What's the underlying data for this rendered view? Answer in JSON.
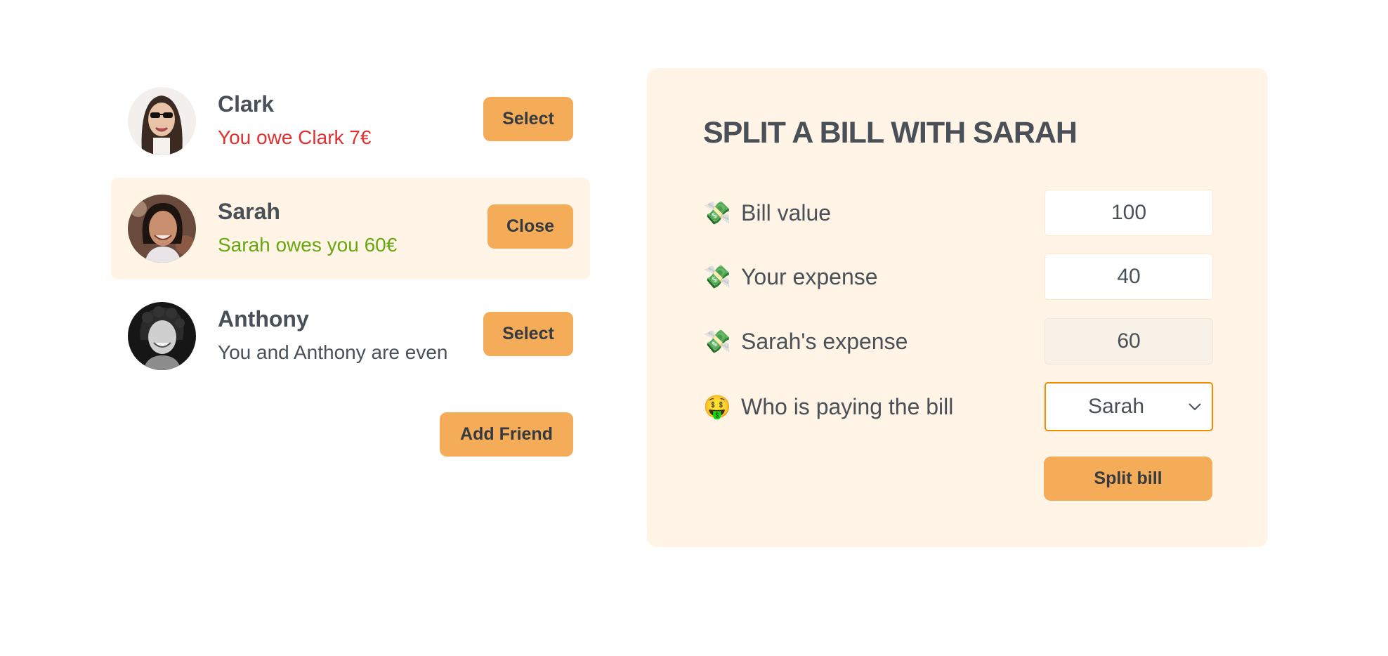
{
  "friends": [
    {
      "name": "Clark",
      "status": "You owe Clark 7€",
      "button_label": "Select"
    },
    {
      "name": "Sarah",
      "status": "Sarah owes you 60€",
      "button_label": "Close"
    },
    {
      "name": "Anthony",
      "status": "You and Anthony are even",
      "button_label": "Select"
    }
  ],
  "add_friend_label": "Add Friend",
  "split_form": {
    "title": "SPLIT A BILL WITH SARAH",
    "bill_value": {
      "emoji": "💸",
      "label": "Bill value",
      "value": "100"
    },
    "your_expense": {
      "emoji": "💸",
      "label": "Your expense",
      "value": "40"
    },
    "friend_expense": {
      "emoji": "💸",
      "label": "Sarah's expense",
      "value": "60"
    },
    "payer": {
      "emoji": "🤑",
      "label": "Who is paying the bill",
      "selected": "Sarah"
    },
    "submit_label": "Split bill"
  },
  "colors": {
    "accent": "#f4ac59",
    "panel_background": "#fff4e6",
    "owe_red": "#e03131",
    "owed_green": "#66a80f",
    "text": "#495057"
  }
}
